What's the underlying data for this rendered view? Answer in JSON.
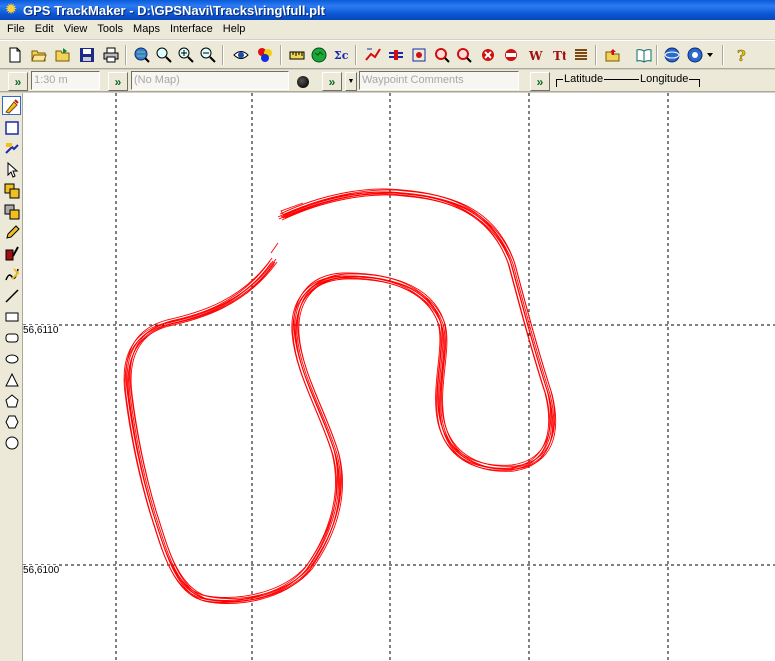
{
  "window": {
    "title": "GPS TrackMaker - D:\\GPSNavi\\Tracks\\ring\\full.plt"
  },
  "menu": [
    "File",
    "Edit",
    "View",
    "Tools",
    "Maps",
    "Interface",
    "Help"
  ],
  "toolbar_icons": [
    "new-file-icon",
    "open-folder-icon",
    "open-recent-icon",
    "save-icon",
    "print-icon",
    "globe-search-icon",
    "zoom-icon",
    "zoom-in-icon",
    "zoom-out-icon",
    "eye-icon",
    "colors-icon",
    "ruler-icon",
    "globe-icon",
    "formula-icon",
    "track-icon",
    "route-icon",
    "waypoint-icon",
    "find-icon",
    "find-next-icon",
    "delete-icon",
    "reverse-icon",
    "waypoint-text-icon",
    "text-icon",
    "list-icon",
    "folder-up-icon",
    "book-icon",
    "gps-icon",
    "gps-dropdown-icon",
    "help-icon"
  ],
  "infobar": {
    "scale": "1:30 m",
    "map": "(No Map)",
    "waypoint_comments": "Waypoint Comments",
    "latitude_label": "Latitude",
    "longitude_label": "Longitude"
  },
  "sidebar_tools": [
    "select-map-tool-icon",
    "rectangle-select-icon",
    "pan-tool-icon",
    "pointer-tool-icon",
    "copy-tool-icon",
    "paste-tool-icon",
    "pencil-tool-icon",
    "track-draw-tool-icon",
    "route-draw-tool-icon",
    "line-tool-icon",
    "rectangle-tool-icon",
    "rounded-rect-tool-icon",
    "ellipse-tool-icon",
    "triangle-tool-icon",
    "pentagon-tool-icon",
    "hexagon-tool-icon",
    "circle-tool-icon"
  ],
  "map": {
    "grid_labels": [
      "56,6110",
      "56,6100"
    ],
    "track_color": "#ff0000"
  }
}
